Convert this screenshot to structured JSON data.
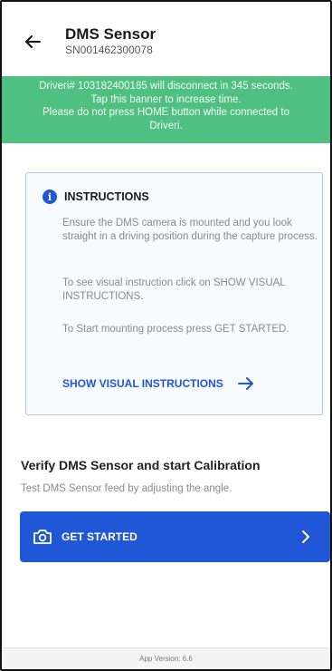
{
  "header": {
    "title": "DMS Sensor",
    "subtitle": "SN001462300078",
    "back_icon": "arrow-left-icon"
  },
  "banner": {
    "lines": [
      "Driveri# 103182400185 will disconnect in 345 seconds.",
      "Tap this banner to increase time.",
      "Please do not press HOME button while connected to",
      "Driveri."
    ],
    "color": "#4fbf82"
  },
  "instructions": {
    "icon": "info-icon",
    "title": "INSTRUCTIONS",
    "paragraphs": [
      "Ensure the DMS camera is mounted and you look straight in a driving position during the capture process.",
      "To see visual instruction click on SHOW VISUAL INSTRUCTIONS.",
      "To Start mounting process press GET STARTED."
    ],
    "link_label": "SHOW VISUAL INSTRUCTIONS",
    "link_icon": "arrow-right-icon"
  },
  "verify": {
    "title": "Verify DMS Sensor and start Calibration",
    "subtitle": "Test DMS Sensor feed by adjusting the angle."
  },
  "start_button": {
    "label": "GET STARTED",
    "icon": "camera-icon",
    "chevron_icon": "chevron-right-icon",
    "color": "#1f57d6"
  },
  "footer": {
    "version": "App Version: 6.6"
  }
}
